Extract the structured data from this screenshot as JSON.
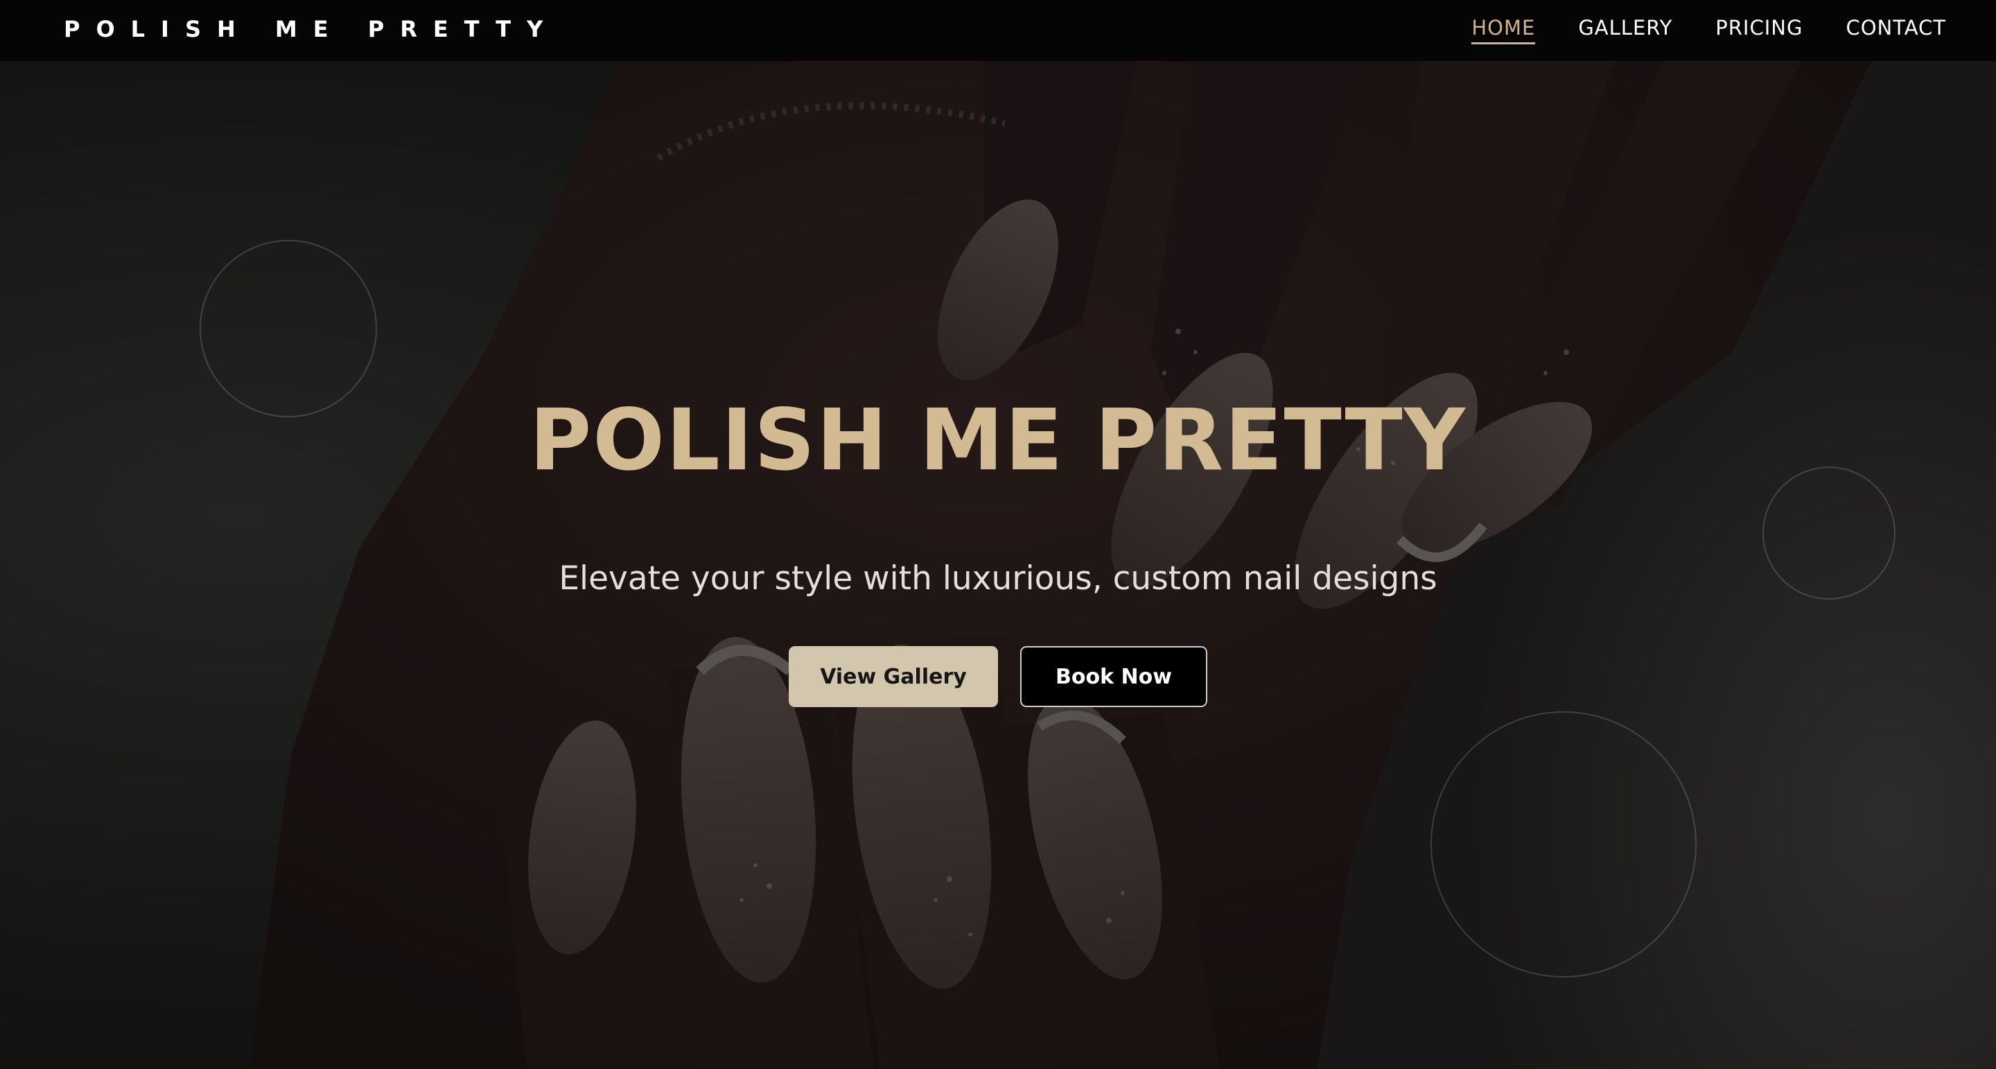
{
  "header": {
    "brand": "POLISH ME PRETTY",
    "nav": [
      {
        "label": "HOME",
        "active": true
      },
      {
        "label": "GALLERY",
        "active": false
      },
      {
        "label": "PRICING",
        "active": false
      },
      {
        "label": "CONTACT",
        "active": false
      }
    ]
  },
  "hero": {
    "title": "POLISH ME PRETTY",
    "subtitle": "Elevate your style with luxurious, custom nail designs",
    "primary_button": "View Gallery",
    "secondary_button": "Book Now",
    "background_image": "close-up of manicured hands with almond-shaped nude french-tip nails, glitter and botanical accents, on white fur"
  },
  "colors": {
    "accent": "#d2bb92",
    "nav_active": "#cdb48c",
    "header_bg": "#050505",
    "primary_button_bg": "#d2c6ac",
    "secondary_button_bg": "#000000"
  }
}
